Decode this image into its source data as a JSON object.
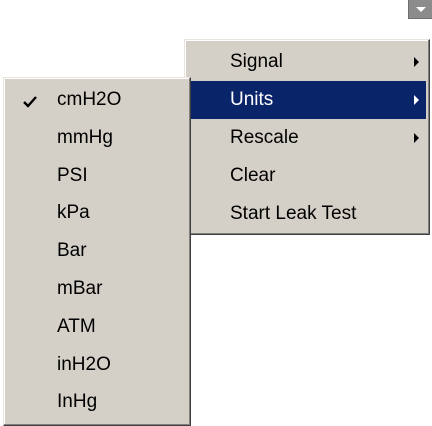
{
  "corner_button": {
    "icon": "chevron-down-icon"
  },
  "context_menu": {
    "items": [
      {
        "label": "Signal",
        "has_submenu": true,
        "highlighted": false
      },
      {
        "label": "Units",
        "has_submenu": true,
        "highlighted": true
      },
      {
        "label": "Rescale",
        "has_submenu": true,
        "highlighted": false
      },
      {
        "label": "Clear",
        "has_submenu": false,
        "highlighted": false
      },
      {
        "label": "Start Leak Test",
        "has_submenu": false,
        "highlighted": false
      }
    ]
  },
  "units_submenu": {
    "selected": "cmH2O",
    "items": [
      {
        "label": "cmH2O",
        "checked": true
      },
      {
        "label": "mmHg",
        "checked": false
      },
      {
        "label": "PSI",
        "checked": false
      },
      {
        "label": "kPa",
        "checked": false
      },
      {
        "label": "Bar",
        "checked": false
      },
      {
        "label": "mBar",
        "checked": false
      },
      {
        "label": "ATM",
        "checked": false
      },
      {
        "label": "inH2O",
        "checked": false
      },
      {
        "label": "InHg",
        "checked": false
      }
    ]
  },
  "colors": {
    "menu_bg": "#d4d0c8",
    "highlight_bg": "#0a246a",
    "highlight_text": "#ffffff"
  }
}
